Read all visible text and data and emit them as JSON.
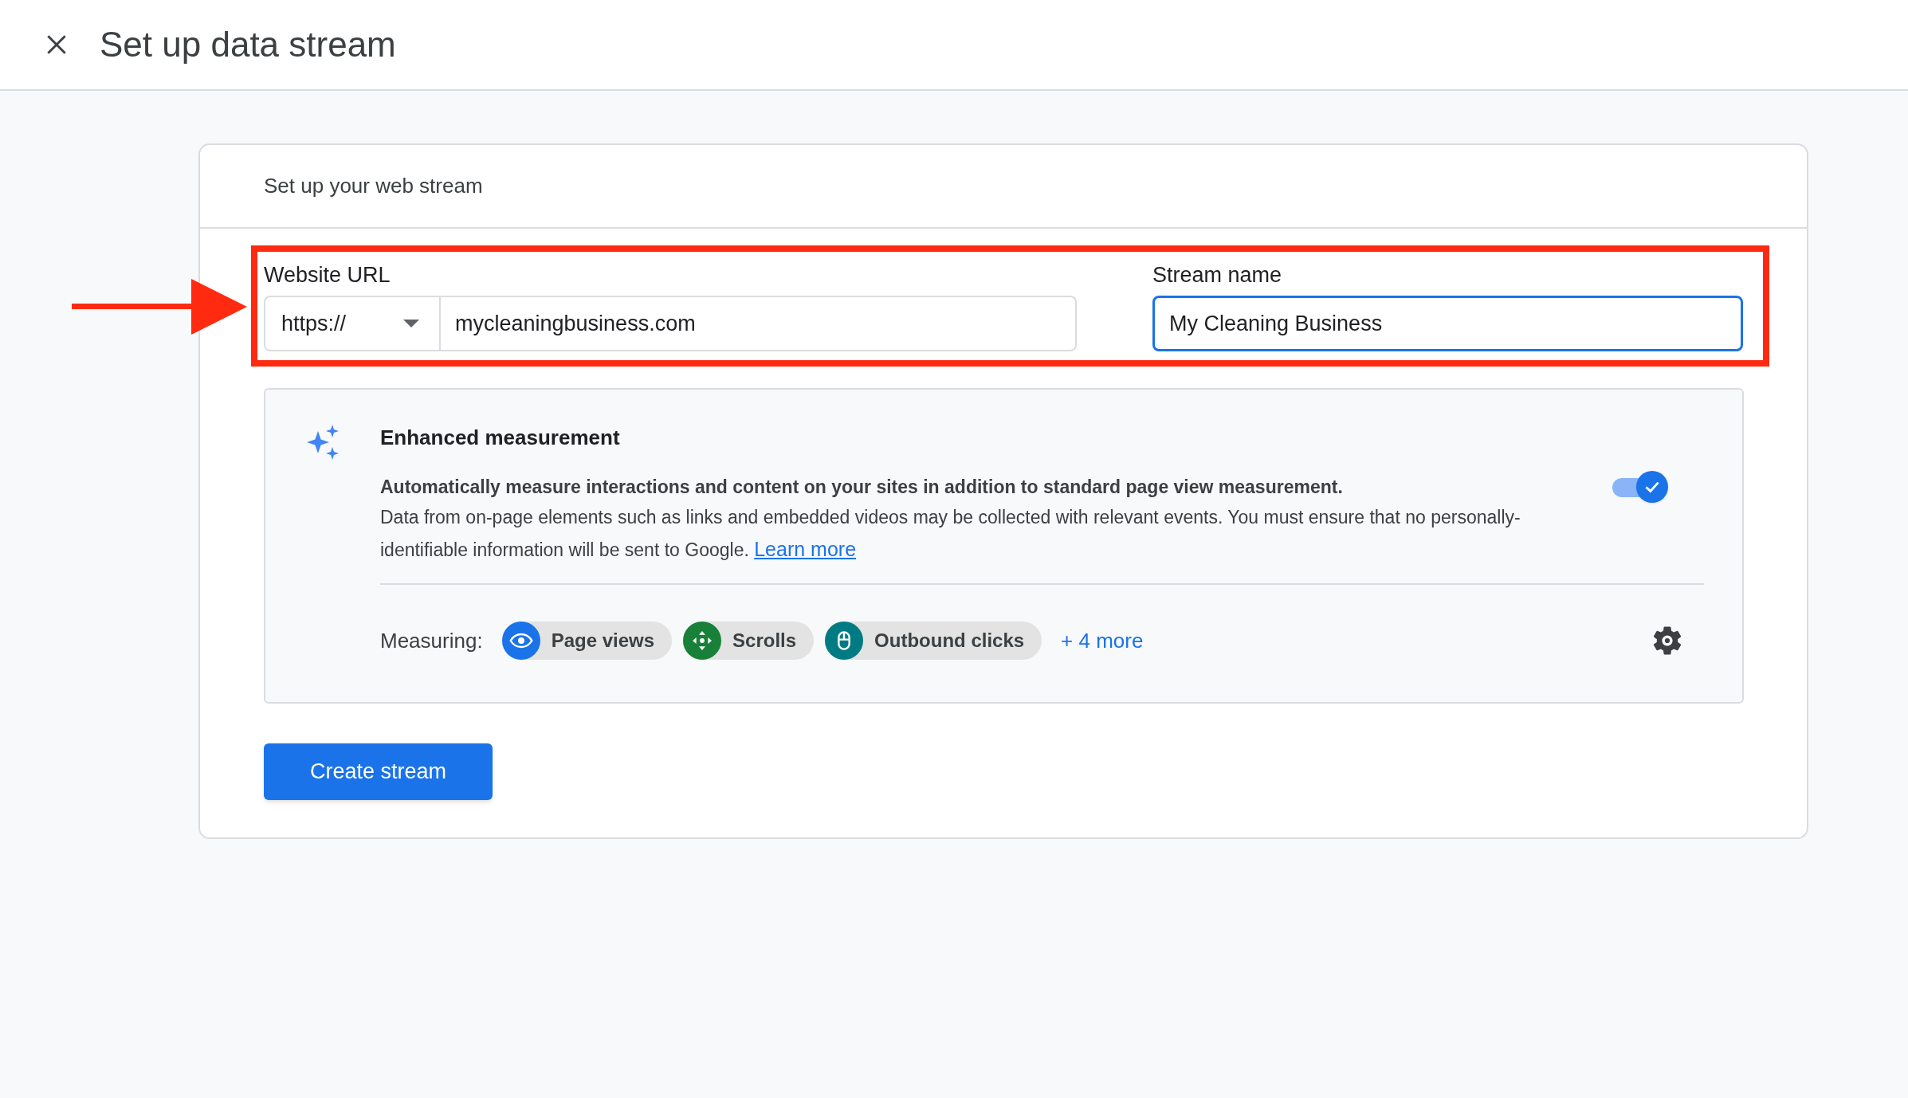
{
  "header": {
    "title": "Set up data stream"
  },
  "card": {
    "title": "Set up your web stream",
    "website_url": {
      "label": "Website URL",
      "protocol": "https://",
      "value": "mycleaningbusiness.com"
    },
    "stream_name": {
      "label": "Stream name",
      "value": "My Cleaning Business",
      "focused": true
    },
    "enhanced_measurement": {
      "title": "Enhanced measurement",
      "lead": "Automatically measure interactions and content on your sites in addition to standard page view measurement.",
      "description": "Data from on-page elements such as links and embedded videos may be collected with relevant events. You must ensure that no personally-identifiable information will be sent to Google.",
      "link": "Learn more",
      "on": true,
      "measuring_label": "Measuring:",
      "chips": [
        {
          "kind": "eye",
          "label": "Page views",
          "color": "#1a73e8"
        },
        {
          "kind": "scroll",
          "label": "Scrolls",
          "color": "#188038"
        },
        {
          "kind": "mouse",
          "label": "Outbound clicks",
          "color": "#007b83"
        }
      ],
      "more": "+ 4 more"
    },
    "button": "Create stream"
  }
}
